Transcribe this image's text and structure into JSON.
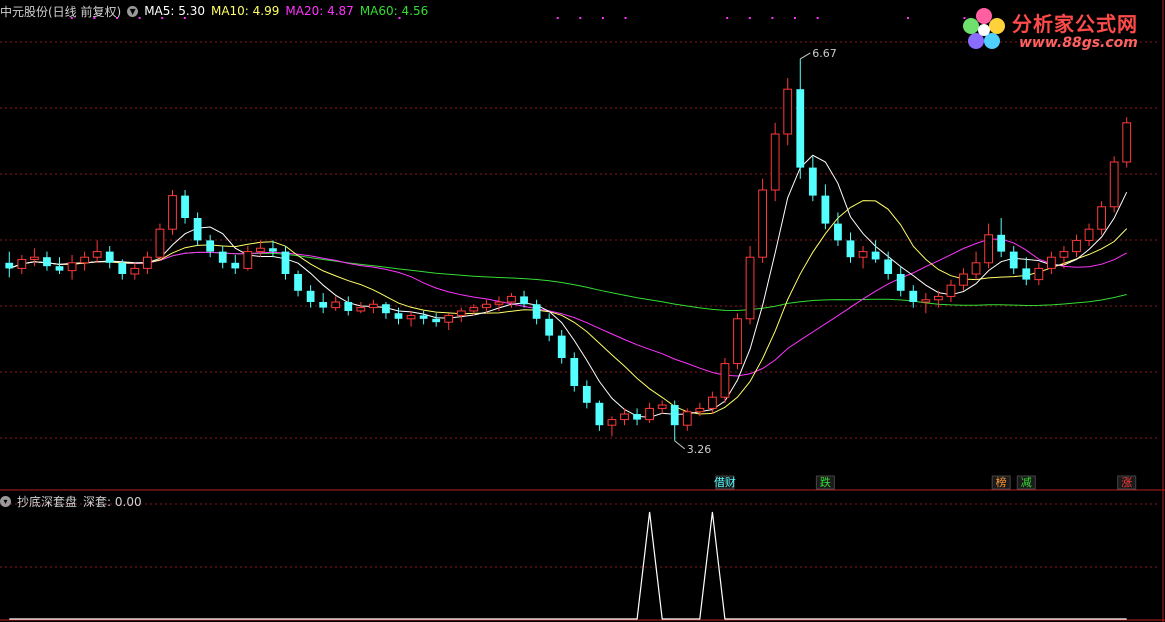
{
  "header": {
    "stock": "中元股份(日线 前复权)",
    "ma5": "MA5: 5.30",
    "ma10": "MA10: 4.99",
    "ma20": "MA20: 4.87",
    "ma60": "MA60: 4.56"
  },
  "indicator": {
    "name": "抄底深套盘",
    "value": "深套: 0.00"
  },
  "logo": {
    "brand": "分析家公式网",
    "url": "www.88gs.com"
  },
  "colors": {
    "up": "#ff3a3a",
    "down": "#54ffff",
    "ma5": "#ffffff",
    "ma10": "#ffff66",
    "ma20": "#ff33ff",
    "ma60": "#33dd33",
    "grid": "#8a1a1a"
  },
  "chart_data": [
    {
      "type": "candlestick",
      "title": "中元股份(日线 前复权)",
      "ylim": [
        3.0,
        7.0
      ],
      "annotations": [
        {
          "text": "6.67",
          "kind": "high",
          "index": 63
        },
        {
          "text": "3.26",
          "kind": "low",
          "index": 53
        }
      ],
      "event_labels": [
        {
          "text": "借财",
          "index": 57,
          "color": "#54ffff"
        },
        {
          "text": "跌",
          "index": 65,
          "color": "#33dd33"
        },
        {
          "text": "榜",
          "index": 79,
          "color": "#ff9933"
        },
        {
          "text": "减",
          "index": 81,
          "color": "#33dd33"
        },
        {
          "text": "涨",
          "index": 89,
          "color": "#ff3a3a"
        }
      ],
      "candles": [
        [
          4.85,
          4.95,
          4.72,
          4.8
        ],
        [
          4.8,
          4.92,
          4.75,
          4.88
        ],
        [
          4.88,
          4.98,
          4.82,
          4.9
        ],
        [
          4.9,
          4.95,
          4.78,
          4.82
        ],
        [
          4.82,
          4.9,
          4.75,
          4.78
        ],
        [
          4.78,
          4.92,
          4.7,
          4.85
        ],
        [
          4.85,
          4.95,
          4.78,
          4.9
        ],
        [
          4.9,
          5.05,
          4.85,
          4.95
        ],
        [
          4.95,
          5.0,
          4.8,
          4.85
        ],
        [
          4.85,
          4.88,
          4.7,
          4.75
        ],
        [
          4.75,
          4.85,
          4.7,
          4.8
        ],
        [
          4.8,
          4.95,
          4.75,
          4.9
        ],
        [
          4.9,
          5.2,
          4.88,
          5.15
        ],
        [
          5.15,
          5.5,
          5.1,
          5.45
        ],
        [
          5.45,
          5.5,
          5.2,
          5.25
        ],
        [
          5.25,
          5.3,
          5.0,
          5.05
        ],
        [
          5.05,
          5.1,
          4.9,
          4.95
        ],
        [
          4.95,
          5.0,
          4.8,
          4.85
        ],
        [
          4.85,
          4.92,
          4.75,
          4.8
        ],
        [
          4.8,
          5.0,
          4.78,
          4.95
        ],
        [
          4.95,
          5.05,
          4.9,
          4.98
        ],
        [
          4.98,
          5.05,
          4.9,
          4.95
        ],
        [
          4.95,
          5.0,
          4.7,
          4.75
        ],
        [
          4.75,
          4.78,
          4.55,
          4.6
        ],
        [
          4.6,
          4.65,
          4.45,
          4.5
        ],
        [
          4.5,
          4.58,
          4.4,
          4.45
        ],
        [
          4.45,
          4.55,
          4.42,
          4.5
        ],
        [
          4.5,
          4.55,
          4.38,
          4.42
        ],
        [
          4.42,
          4.5,
          4.4,
          4.45
        ],
        [
          4.45,
          4.52,
          4.4,
          4.48
        ],
        [
          4.48,
          4.5,
          4.35,
          4.4
        ],
        [
          4.4,
          4.45,
          4.3,
          4.35
        ],
        [
          4.35,
          4.42,
          4.28,
          4.38
        ],
        [
          4.38,
          4.42,
          4.3,
          4.35
        ],
        [
          4.35,
          4.4,
          4.28,
          4.32
        ],
        [
          4.32,
          4.4,
          4.25,
          4.38
        ],
        [
          4.38,
          4.45,
          4.32,
          4.42
        ],
        [
          4.42,
          4.48,
          4.38,
          4.45
        ],
        [
          4.45,
          4.52,
          4.4,
          4.48
        ],
        [
          4.48,
          4.55,
          4.42,
          4.5
        ],
        [
          4.5,
          4.58,
          4.45,
          4.55
        ],
        [
          4.55,
          4.6,
          4.45,
          4.48
        ],
        [
          4.48,
          4.52,
          4.3,
          4.35
        ],
        [
          4.35,
          4.4,
          4.15,
          4.2
        ],
        [
          4.2,
          4.25,
          3.95,
          4.0
        ],
        [
          4.0,
          4.05,
          3.7,
          3.75
        ],
        [
          3.75,
          3.8,
          3.55,
          3.6
        ],
        [
          3.6,
          3.62,
          3.35,
          3.4
        ],
        [
          3.4,
          3.48,
          3.3,
          3.45
        ],
        [
          3.45,
          3.55,
          3.4,
          3.5
        ],
        [
          3.5,
          3.55,
          3.4,
          3.45
        ],
        [
          3.45,
          3.6,
          3.42,
          3.55
        ],
        [
          3.55,
          3.62,
          3.5,
          3.58
        ],
        [
          3.58,
          3.62,
          3.26,
          3.4
        ],
        [
          3.4,
          3.55,
          3.35,
          3.52
        ],
        [
          3.52,
          3.6,
          3.48,
          3.55
        ],
        [
          3.55,
          3.7,
          3.5,
          3.65
        ],
        [
          3.65,
          4.0,
          3.6,
          3.95
        ],
        [
          3.95,
          4.4,
          3.9,
          4.35
        ],
        [
          4.35,
          5.0,
          4.3,
          4.9
        ],
        [
          4.9,
          5.6,
          4.85,
          5.5
        ],
        [
          5.5,
          6.1,
          5.4,
          6.0
        ],
        [
          6.0,
          6.5,
          5.9,
          6.4
        ],
        [
          6.4,
          6.67,
          5.6,
          5.7
        ],
        [
          5.7,
          5.8,
          5.4,
          5.45
        ],
        [
          5.45,
          5.55,
          5.15,
          5.2
        ],
        [
          5.2,
          5.3,
          5.0,
          5.05
        ],
        [
          5.05,
          5.12,
          4.85,
          4.9
        ],
        [
          4.9,
          5.0,
          4.8,
          4.95
        ],
        [
          4.95,
          5.05,
          4.85,
          4.88
        ],
        [
          4.88,
          4.95,
          4.7,
          4.75
        ],
        [
          4.75,
          4.82,
          4.55,
          4.6
        ],
        [
          4.6,
          4.65,
          4.45,
          4.5
        ],
        [
          4.5,
          4.58,
          4.4,
          4.52
        ],
        [
          4.52,
          4.6,
          4.45,
          4.55
        ],
        [
          4.55,
          4.7,
          4.5,
          4.65
        ],
        [
          4.65,
          4.8,
          4.6,
          4.75
        ],
        [
          4.75,
          4.95,
          4.7,
          4.85
        ],
        [
          4.85,
          5.2,
          4.8,
          5.1
        ],
        [
          5.1,
          5.25,
          4.9,
          4.95
        ],
        [
          4.95,
          5.0,
          4.75,
          4.8
        ],
        [
          4.8,
          4.9,
          4.65,
          4.7
        ],
        [
          4.7,
          4.85,
          4.65,
          4.8
        ],
        [
          4.8,
          4.95,
          4.75,
          4.9
        ],
        [
          4.9,
          5.0,
          4.8,
          4.95
        ],
        [
          4.95,
          5.1,
          4.9,
          5.05
        ],
        [
          5.05,
          5.2,
          5.0,
          5.15
        ],
        [
          5.15,
          5.4,
          5.1,
          5.35
        ],
        [
          5.35,
          5.8,
          5.3,
          5.75
        ],
        [
          5.75,
          6.15,
          5.7,
          6.1
        ]
      ]
    },
    {
      "type": "line",
      "title": "抄底深套盘",
      "series": [
        {
          "name": "深套",
          "values": [
            0,
            0,
            0,
            0,
            0,
            0,
            0,
            0,
            0,
            0,
            0,
            0,
            0,
            0,
            0,
            0,
            0,
            0,
            0,
            0,
            0,
            0,
            0,
            0,
            0,
            0,
            0,
            0,
            0,
            0,
            0,
            0,
            0,
            0,
            0,
            0,
            0,
            0,
            0,
            0,
            0,
            0,
            0,
            0,
            0,
            0,
            0,
            0,
            0,
            0,
            0,
            1,
            0,
            0,
            0,
            0,
            1,
            0,
            0,
            0,
            0,
            0,
            0,
            0,
            0,
            0,
            0,
            0,
            0,
            0,
            0,
            0,
            0,
            0,
            0,
            0,
            0,
            0,
            0,
            0,
            0,
            0,
            0,
            0,
            0,
            0,
            0,
            0,
            0,
            0
          ]
        }
      ],
      "ylim": [
        0,
        1
      ]
    }
  ]
}
